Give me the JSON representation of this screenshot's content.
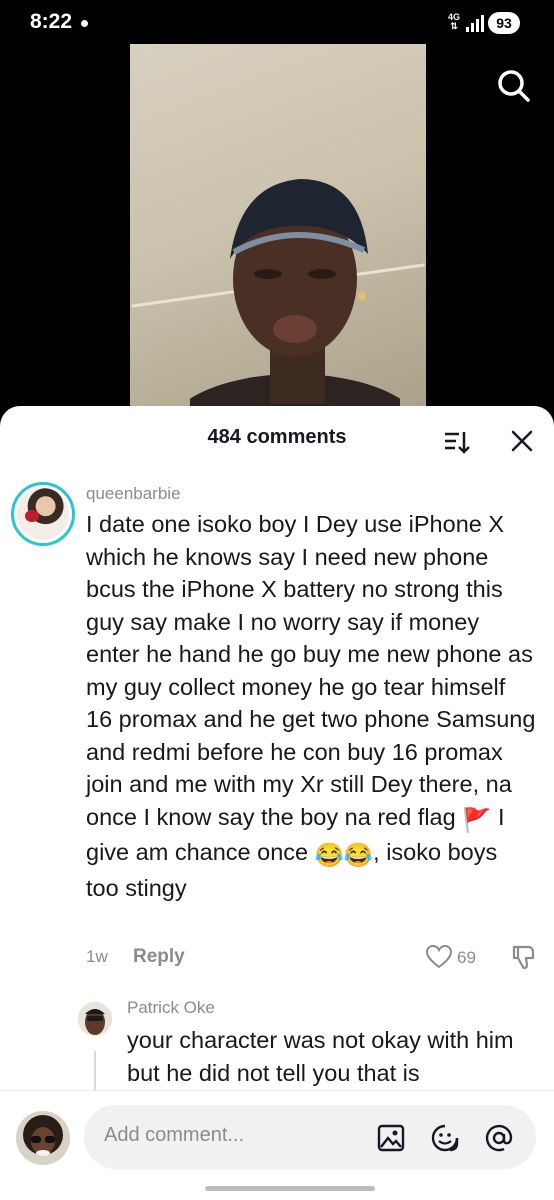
{
  "status_bar": {
    "time": "8:22",
    "network": "4G",
    "battery": "93"
  },
  "video": {
    "search_icon": "search-icon"
  },
  "comments_sheet": {
    "count_label": "484 comments",
    "sort_icon": "sort-icon",
    "close_icon": "close-icon"
  },
  "comment_1": {
    "username": "queenbarbie",
    "text_a": "I date one isoko boy I Dey use iPhone X which he knows say I need new phone bcus the iPhone X battery no strong this guy say make I no worry say if money enter he hand he go buy me new phone as my guy collect money he go tear himself 16 promax and he get two phone Samsung and redmi before he con buy 16 promax join and me with my Xr still Dey there, na once I know say the boy na red flag ",
    "emoji_flag": "🚩",
    "text_b": " I give am chance once ",
    "emoji_laugh": "😂😂",
    "text_c": ", isoko boys too stingy",
    "age": "1w",
    "reply_label": "Reply",
    "like_count": "69"
  },
  "comment_2": {
    "username": "Patrick Oke",
    "text": "your character was not okay with him but he did not tell you that is"
  },
  "composer": {
    "placeholder": "Add comment...",
    "icons": [
      "image-icon",
      "emoji-icon",
      "mention-icon"
    ]
  }
}
